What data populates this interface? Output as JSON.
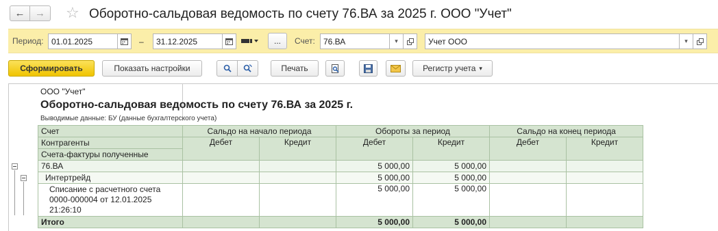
{
  "window": {
    "title": "Оборотно-сальдовая ведомость по счету 76.ВА за 2025 г. ООО \"Учет\""
  },
  "filters": {
    "period_label": "Период:",
    "date_from": "01.01.2025",
    "dash": "–",
    "date_to": "31.12.2025",
    "more_label": "...",
    "account_label": "Счет:",
    "account_value": "76.ВА",
    "org_value": "Учет ООО"
  },
  "toolbar": {
    "generate_label": "Сформировать",
    "settings_label": "Показать настройки",
    "print_label": "Печать",
    "register_label": "Регистр учета"
  },
  "report": {
    "org": "ООО \"Учет\"",
    "title": "Оборотно-сальдовая ведомость по счету 76.ВА за 2025 г.",
    "subtitle": "Выводимые данные:  БУ (данные бухгалтерского учета)",
    "header": {
      "col_account": "Счет",
      "col_contractor": "Контрагенты",
      "col_invoices": "Счета-фактуры полученные",
      "group_open": "Сальдо на начало периода",
      "group_turnover": "Обороты за период",
      "group_close": "Сальдо на конец периода",
      "debit": "Дебет",
      "credit": "Кредит"
    },
    "rows": [
      {
        "label": "76.ВА",
        "open_debit": "",
        "open_credit": "",
        "turn_debit": "5 000,00",
        "turn_credit": "5 000,00",
        "close_debit": "",
        "close_credit": ""
      },
      {
        "label": "Интертрейд",
        "open_debit": "",
        "open_credit": "",
        "turn_debit": "5 000,00",
        "turn_credit": "5 000,00",
        "close_debit": "",
        "close_credit": ""
      },
      {
        "label": "Списание с расчетного счета 0000-000004 от 12.01.2025 21:26:10",
        "open_debit": "",
        "open_credit": "",
        "turn_debit": "5 000,00",
        "turn_credit": "5 000,00",
        "close_debit": "",
        "close_credit": ""
      }
    ],
    "total": {
      "label": "Итого",
      "turn_debit": "5 000,00",
      "turn_credit": "5 000,00"
    }
  },
  "icons": {
    "back": "arrow-left-icon",
    "forward": "arrow-right-icon",
    "favorite": "star-icon",
    "calendar": "calendar-icon",
    "search": "search-icon",
    "search_next": "search-next-icon",
    "preview": "print-preview-icon",
    "save": "save-icon",
    "mail": "mail-icon"
  },
  "colors": {
    "filter_bg": "#fbeea9",
    "primary_button": "#f0c400",
    "table_header": "#d5e4d0"
  }
}
